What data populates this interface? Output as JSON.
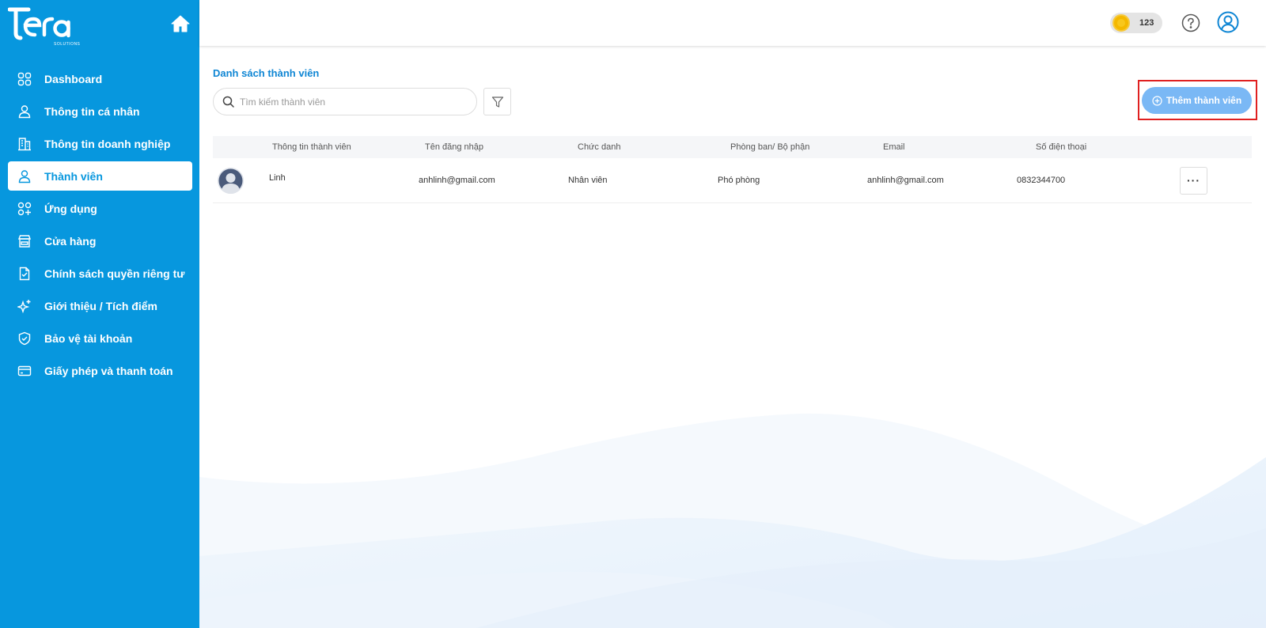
{
  "brand": {
    "name": "Tera",
    "tagline": "SOLUTIONS"
  },
  "sidebar": {
    "items": [
      {
        "label": "Dashboard",
        "icon": "grid-icon"
      },
      {
        "label": "Thông tin cá nhân",
        "icon": "user-icon"
      },
      {
        "label": "Thông tin doanh nghiệp",
        "icon": "building-icon"
      },
      {
        "label": "Thành viên",
        "icon": "user-icon",
        "active": true
      },
      {
        "label": "Ứng dụng",
        "icon": "apps-icon"
      },
      {
        "label": "Cửa hàng",
        "icon": "store-icon"
      },
      {
        "label": "Chính sách quyền riêng tư",
        "icon": "document-check-icon"
      },
      {
        "label": "Giới thiệu / Tích điểm",
        "icon": "sparkle-icon"
      },
      {
        "label": "Bảo vệ tài khoản",
        "icon": "shield-icon"
      },
      {
        "label": "Giấy phép và thanh toán",
        "icon": "credit-card-icon"
      }
    ]
  },
  "header": {
    "coins": "123"
  },
  "main": {
    "title": "Danh sách thành viên",
    "search_placeholder": "Tìm kiếm thành viên",
    "add_button": "Thêm thành viên",
    "columns": [
      "Thông tin thành viên",
      "Tên đăng nhập",
      "Chức danh",
      "Phòng ban/ Bộ phận",
      "Email",
      "Số điện thoại"
    ],
    "rows": [
      {
        "name": "Linh",
        "username": "anhlinh@gmail.com",
        "title": "Nhân viên",
        "department": "Phó phòng",
        "email": "anhlinh@gmail.com",
        "phone": "0832344700"
      }
    ],
    "more_label": "···"
  },
  "colors": {
    "sidebar": "#0797de",
    "accent": "#0f86d4",
    "add_button": "#7ab8f5",
    "highlight": "#e02020",
    "coin": "#f4b800"
  }
}
